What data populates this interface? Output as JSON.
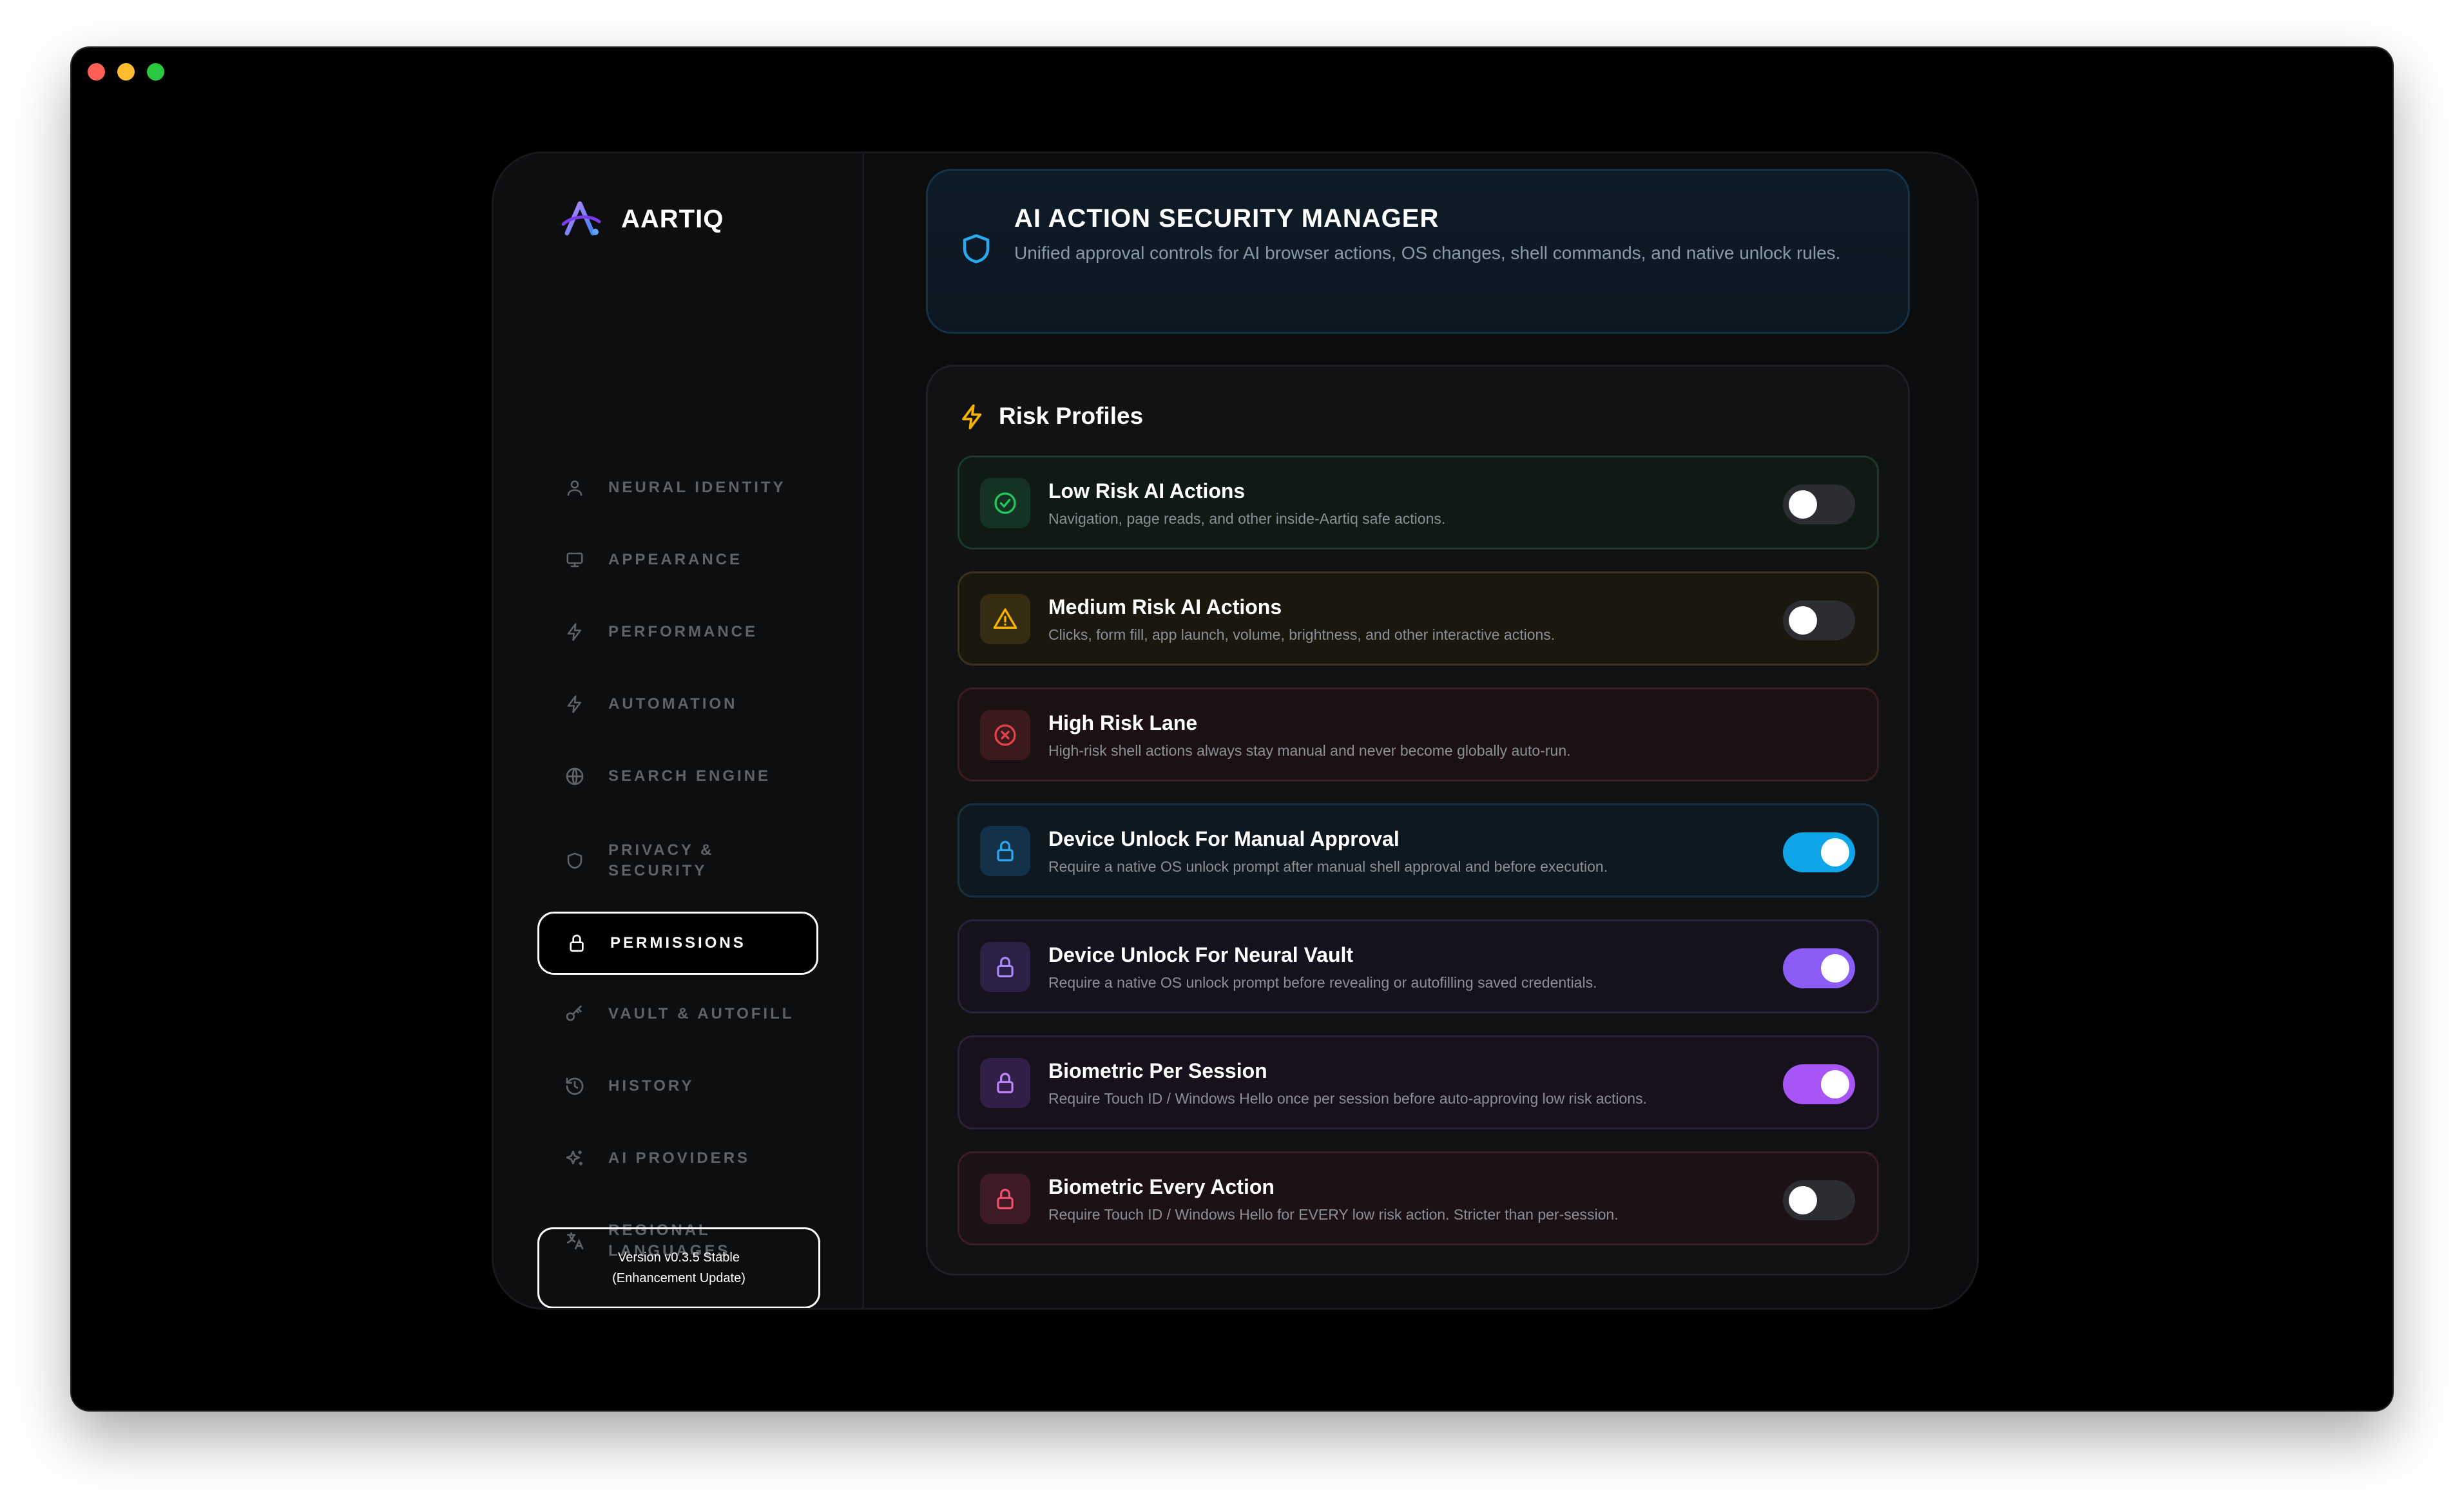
{
  "brand": {
    "name": "AARTIQ"
  },
  "sidebar": {
    "items": [
      {
        "label": "NEURAL IDENTITY",
        "icon": "user-icon"
      },
      {
        "label": "APPEARANCE",
        "icon": "monitor-icon"
      },
      {
        "label": "PERFORMANCE",
        "icon": "bolt-icon"
      },
      {
        "label": "AUTOMATION",
        "icon": "bolt-icon"
      },
      {
        "label": "SEARCH ENGINE",
        "icon": "globe-icon"
      },
      {
        "label": "PRIVACY & SECURITY",
        "icon": "shield-icon"
      },
      {
        "label": "PERMISSIONS",
        "icon": "lock-icon",
        "active": true
      },
      {
        "label": "VAULT & AUTOFILL",
        "icon": "key-icon"
      },
      {
        "label": "HISTORY",
        "icon": "history-icon"
      },
      {
        "label": "AI PROVIDERS",
        "icon": "sparkles-icon"
      },
      {
        "label": "REGIONAL LANGUAGES",
        "icon": "translate-icon"
      }
    ],
    "version_line1": "Version v0.3.5 Stable",
    "version_line2": "(Enhancement Update)"
  },
  "header": {
    "title": "AI ACTION SECURITY MANAGER",
    "subtitle": "Unified approval controls for AI browser actions, OS changes, shell commands, and native unlock rules."
  },
  "risk": {
    "title": "Risk Profiles",
    "rows": [
      {
        "title": "Low Risk AI Actions",
        "desc": "Navigation, page reads, and other inside-Aartiq safe actions.",
        "icon": "check-circle-icon",
        "toggle": false
      },
      {
        "title": "Medium Risk AI Actions",
        "desc": "Clicks, form fill, app launch, volume, brightness, and other interactive actions.",
        "icon": "warning-icon",
        "toggle": false
      },
      {
        "title": "High Risk Lane",
        "desc": "High-risk shell actions always stay manual and never become globally auto-run.",
        "icon": "x-circle-icon",
        "toggle": null
      },
      {
        "title": "Device Unlock For Manual Approval",
        "desc": "Require a native OS unlock prompt after manual shell approval and before execution.",
        "icon": "lock-icon",
        "toggle": true
      },
      {
        "title": "Device Unlock For Neural Vault",
        "desc": "Require a native OS unlock prompt before revealing or autofilling saved credentials.",
        "icon": "lock-icon",
        "toggle": true
      },
      {
        "title": "Biometric Per Session",
        "desc": "Require Touch ID / Windows Hello once per session before auto-approving low risk actions.",
        "icon": "lock-icon",
        "toggle": true
      },
      {
        "title": "Biometric Every Action",
        "desc": "Require Touch ID / Windows Hello for EVERY low risk action. Stricter than per-session.",
        "icon": "lock-icon",
        "toggle": false
      }
    ]
  },
  "colors": {
    "accent_blue": "#0ea5e9",
    "accent_purple": "#a855f7",
    "green": "#22c55e",
    "amber": "#f5b301",
    "red": "#e0424a"
  }
}
